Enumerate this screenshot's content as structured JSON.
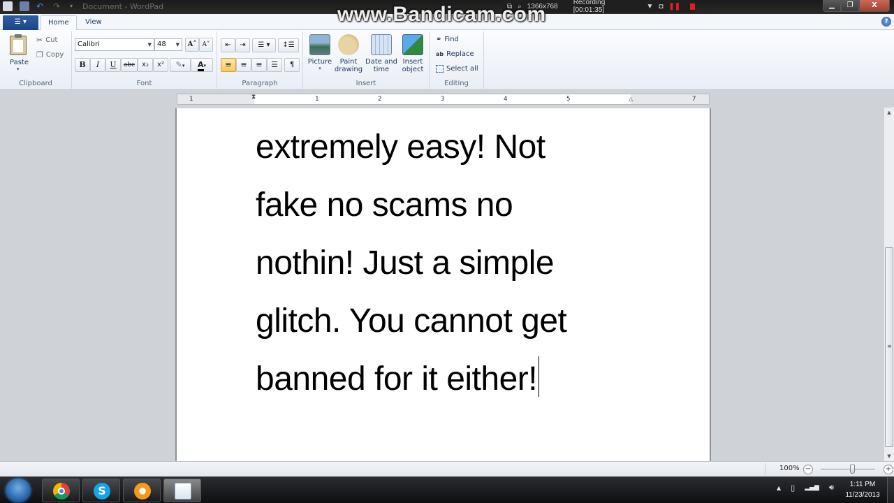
{
  "window": {
    "title": "Document - WordPad",
    "controls": {
      "minimize": "▁",
      "maximize": "❐",
      "close": "X"
    }
  },
  "recorder": {
    "watermark": "www.Bandicam.com",
    "resolution": "1366x768",
    "status": "Recording [00:01:35]"
  },
  "tabs": [
    {
      "label": "Home",
      "active": true
    },
    {
      "label": "View",
      "active": false
    }
  ],
  "ribbon": {
    "clipboard": {
      "label": "Clipboard",
      "paste": "Paste",
      "cut": "Cut",
      "copy": "Copy"
    },
    "font": {
      "label": "Font",
      "family": "Calibri",
      "size": "48",
      "grow": "A˄",
      "shrink": "A˅",
      "bold": "B",
      "italic": "I",
      "underline": "U",
      "strike": "abc",
      "subscript": "x₂",
      "superscript": "x²",
      "highlight": "✎",
      "font_color": "A"
    },
    "paragraph": {
      "label": "Paragraph"
    },
    "insert": {
      "label": "Insert",
      "picture": "Picture",
      "paint_line1": "Paint",
      "paint_line2": "drawing",
      "datetime_line1": "Date and",
      "datetime_line2": "time",
      "object_line1": "Insert",
      "object_line2": "object"
    },
    "editing": {
      "label": "Editing",
      "find": "Find",
      "replace": "Replace",
      "select_all": "Select all"
    }
  },
  "ruler": {
    "ticks": [
      "1",
      "1",
      "2",
      "3",
      "4",
      "5",
      "7"
    ]
  },
  "document": {
    "lines": [
      "extremely easy! Not",
      "fake no scams no",
      "nothin! Just a simple",
      "glitch. You cannot get",
      "banned for it either!"
    ]
  },
  "status": {
    "zoom": "100%",
    "zoom_level_percent": 100
  },
  "taskbar": {
    "apps": [
      "Google Chrome",
      "Skype",
      "avast!",
      "WordPad"
    ],
    "time": "1:11 PM",
    "date": "11/23/2013"
  },
  "colors": {
    "app_menu": "#1b4688",
    "active_align": "#f8c85c",
    "recording_red": "#e02020"
  }
}
